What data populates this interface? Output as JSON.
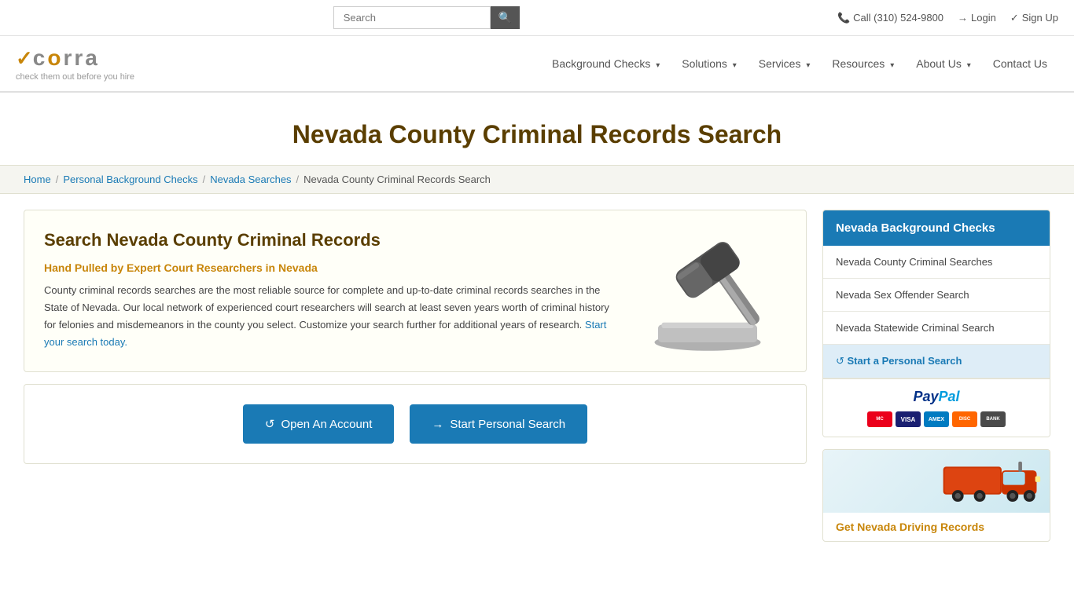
{
  "topbar": {
    "search_placeholder": "Search",
    "search_btn_icon": "🔍",
    "call_label": "Call (310) 524-9800",
    "login_label": "Login",
    "signup_label": "Sign Up"
  },
  "navbar": {
    "logo_text": "CORRA",
    "logo_tagline": "check them out before you hire",
    "nav_items": [
      {
        "label": "Background Checks",
        "has_dropdown": true
      },
      {
        "label": "Solutions",
        "has_dropdown": true
      },
      {
        "label": "Services",
        "has_dropdown": true
      },
      {
        "label": "Resources",
        "has_dropdown": true
      },
      {
        "label": "About Us",
        "has_dropdown": true
      },
      {
        "label": "Contact Us",
        "has_dropdown": false
      }
    ]
  },
  "page_title": "Nevada County Criminal Records Search",
  "breadcrumb": {
    "items": [
      {
        "label": "Home",
        "link": true
      },
      {
        "label": "Personal Background Checks",
        "link": true
      },
      {
        "label": "Nevada Searches",
        "link": true
      },
      {
        "label": "Nevada County Criminal Records Search",
        "link": false
      }
    ]
  },
  "main": {
    "heading": "Search Nevada County Criminal Records",
    "subheading": "Hand Pulled by Expert Court Researchers in Nevada",
    "body": "County criminal records searches are the most reliable source for complete and up-to-date criminal records searches in the State of Nevada. Our local network of experienced court researchers will search at least seven years worth of criminal history for felonies and misdemeanors in the county you select. Customize your search further for additional years of research.",
    "link_text": "Start your search today.",
    "btn_open_account": "Open An Account",
    "btn_start_search": "Start Personal Search"
  },
  "sidebar": {
    "header": "Nevada Background Checks",
    "items": [
      {
        "label": "Nevada County Criminal Searches",
        "active": false
      },
      {
        "label": "Nevada Sex Offender Search",
        "active": false
      },
      {
        "label": "Nevada Statewide Criminal Search",
        "active": false
      },
      {
        "label": "Start a Personal Search",
        "active": true,
        "cta": true
      }
    ]
  },
  "driving_card": {
    "title": "Get Nevada Driving Records"
  }
}
